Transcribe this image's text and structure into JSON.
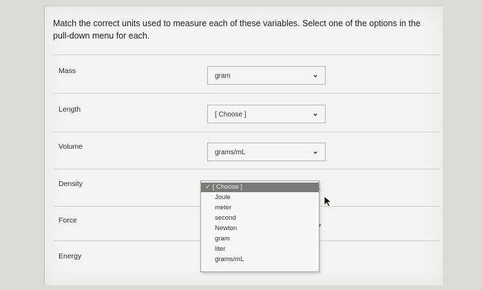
{
  "question": "Match the correct units used to measure each of these variables. Select one of the options in the pull-down menu for each.",
  "rows": [
    {
      "label": "Mass",
      "selected": "gram"
    },
    {
      "label": "Length",
      "selected": "[ Choose ]"
    },
    {
      "label": "Volume",
      "selected": "grams/mL"
    },
    {
      "label": "Density"
    },
    {
      "label": "Force"
    },
    {
      "label": "Energy"
    }
  ],
  "dropdown": {
    "selected": "✓ [ Choose ]",
    "options": [
      "Joule",
      "meter",
      "second",
      "Newton",
      "gram",
      "liter",
      "grams/mL"
    ]
  }
}
